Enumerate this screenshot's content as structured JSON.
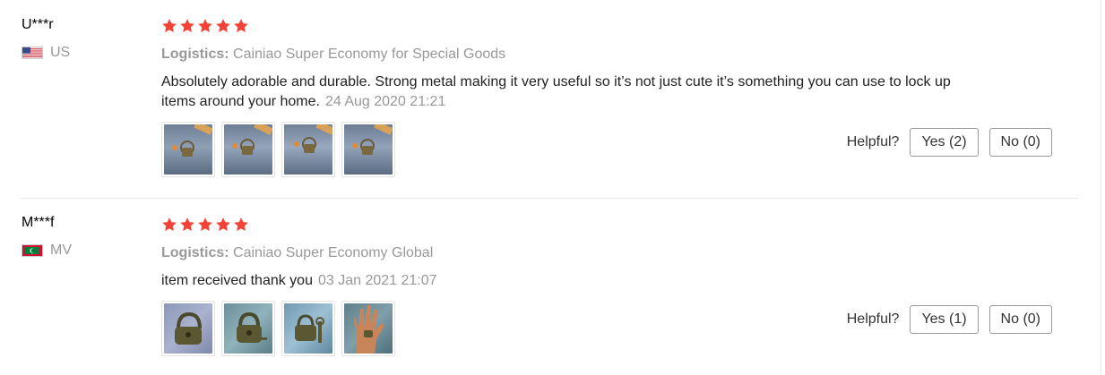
{
  "colors": {
    "star": "#f44336",
    "muted": "#999999",
    "text": "#222222"
  },
  "reviews": [
    {
      "user": "U***r",
      "country_code": "US",
      "flag_icon": "us-flag-icon",
      "rating": 5,
      "logistics_label": "Logistics:",
      "logistics_value": " Cainiao Super Economy for Special Goods",
      "text": "Absolutely adorable and durable. Strong metal making it very useful so it’s not just cute it’s something you can use to lock up items around your home.",
      "date": "24 Aug 2020 21:21",
      "photos": [
        "padlock-photo-1",
        "padlock-photo-2",
        "padlock-photo-3",
        "padlock-photo-4"
      ],
      "helpful_label": "Helpful?",
      "yes_label": "Yes (2)",
      "no_label": "No (0)"
    },
    {
      "user": "M***f",
      "country_code": "MV",
      "flag_icon": "mv-flag-icon",
      "rating": 5,
      "logistics_label": "Logistics:",
      "logistics_value": " Cainiao Super Economy Global",
      "text": "item received thank you",
      "date": "03 Jan 2021 21:07",
      "photos": [
        "padlock-photo-1",
        "padlock-photo-2",
        "padlock-photo-3",
        "hand-photo"
      ],
      "helpful_label": "Helpful?",
      "yes_label": "Yes (1)",
      "no_label": "No (0)"
    }
  ]
}
